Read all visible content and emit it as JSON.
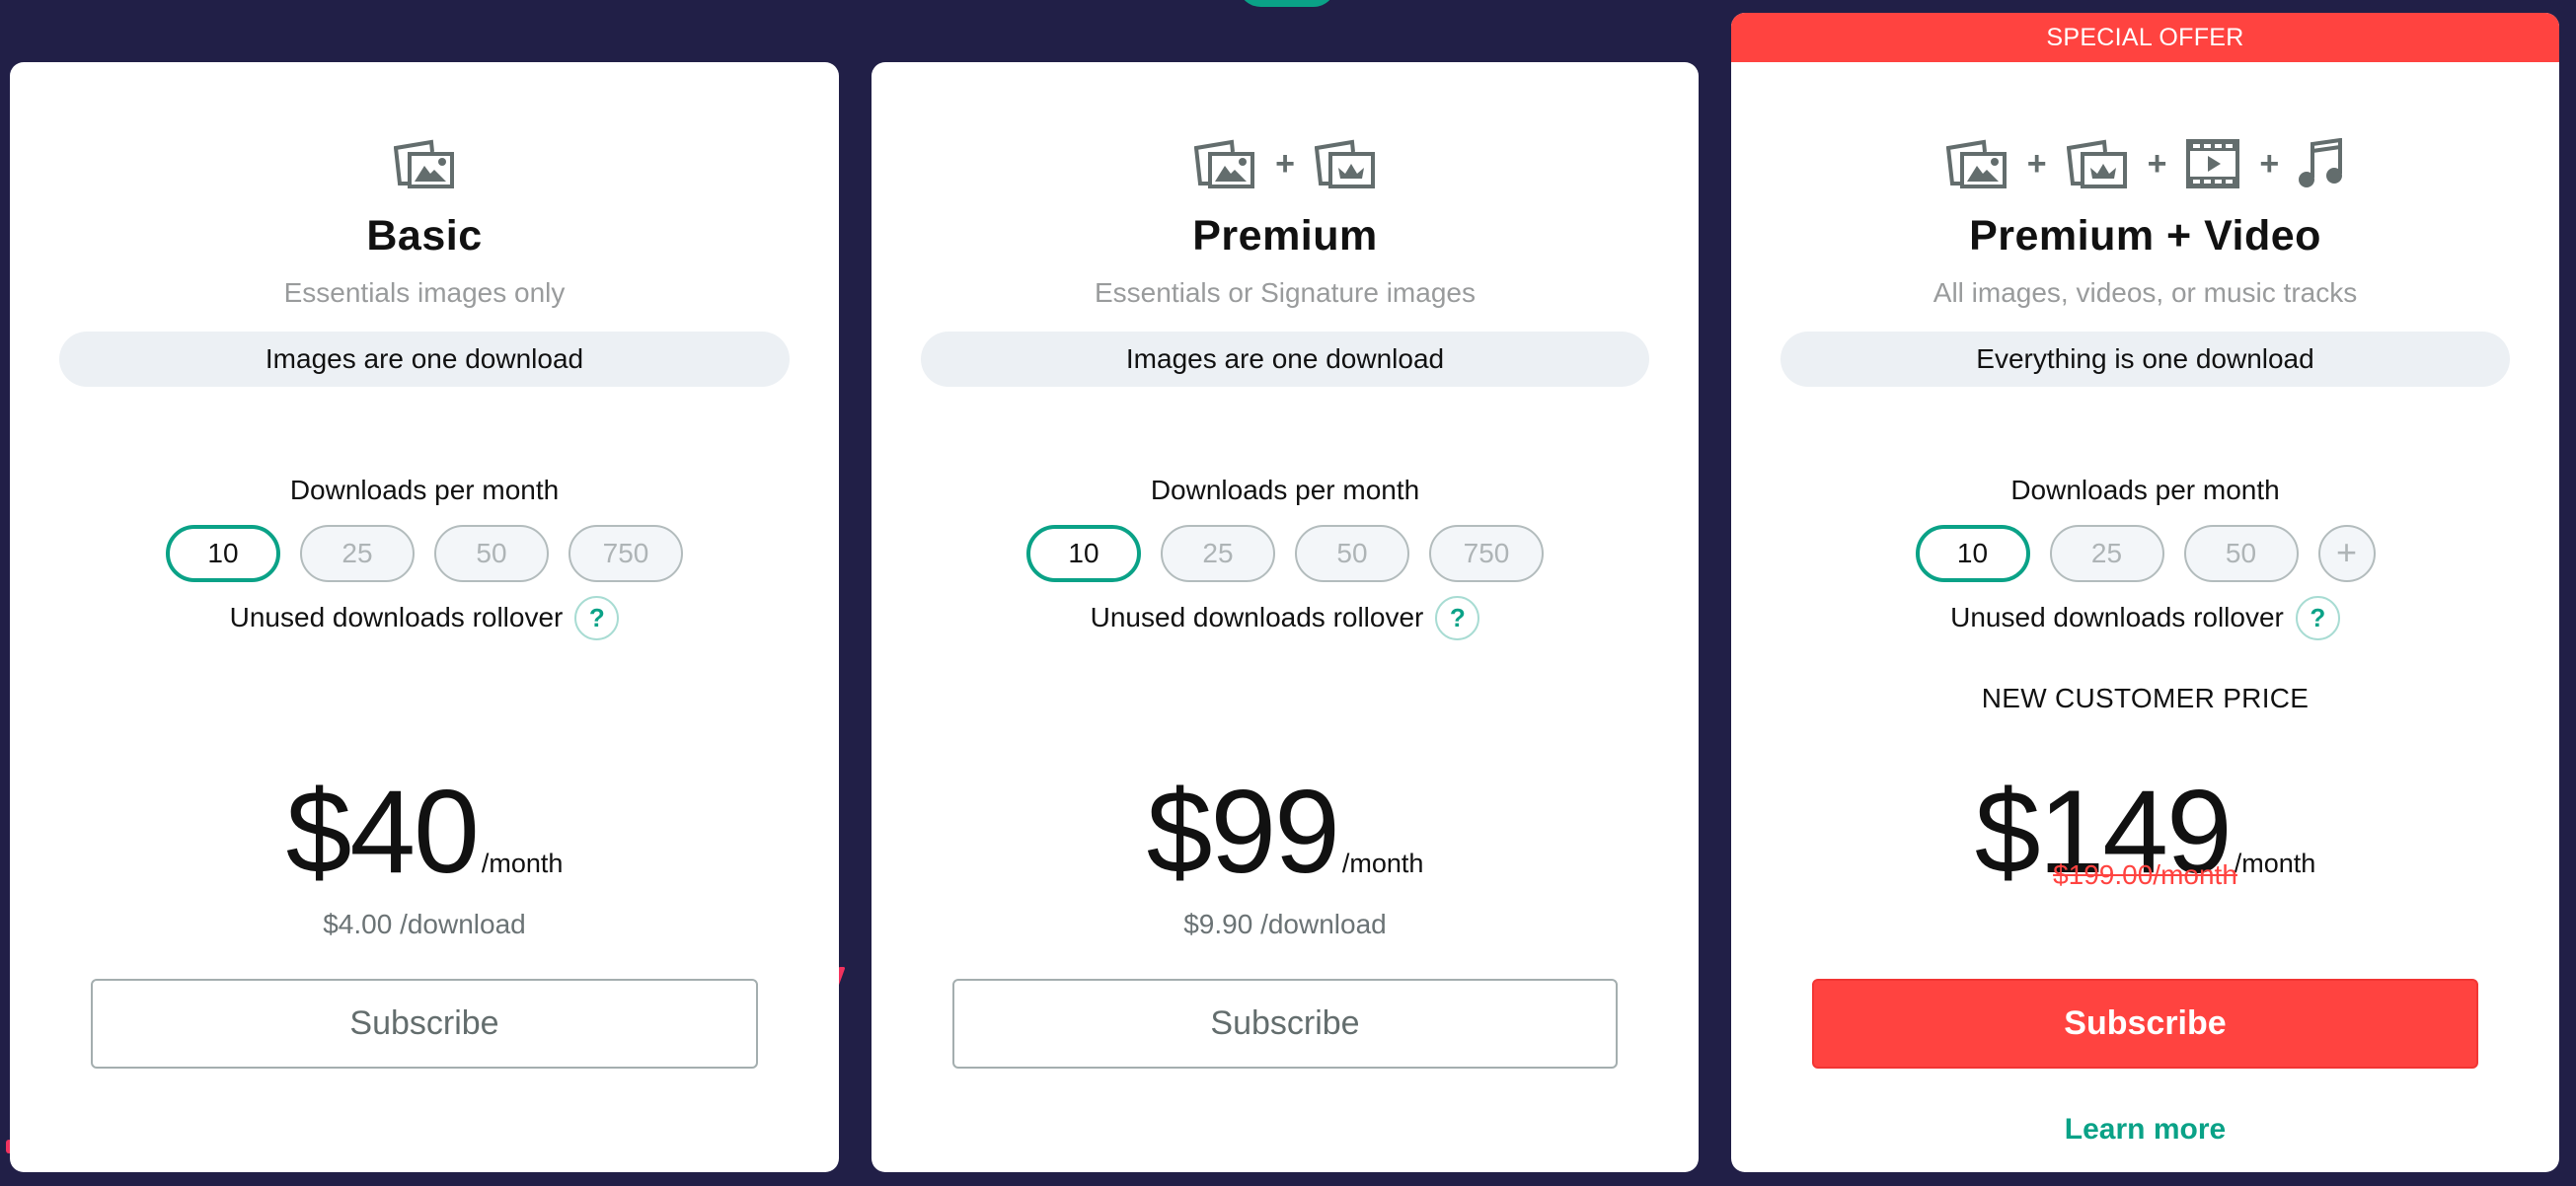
{
  "colors": {
    "background": "#211F47",
    "accent_green": "#0AA287",
    "offer_red": "#FF4340",
    "icon_gray": "#636D6D"
  },
  "plans": [
    {
      "id": "basic",
      "icons": [
        "image-stack-icon"
      ],
      "title": "Basic",
      "subtitle": "Essentials images only",
      "info": "Images are one download",
      "downloads_label": "Downloads per month",
      "options": [
        "10",
        "25",
        "50",
        "750"
      ],
      "selected_option": "10",
      "rollover_label": "Unused downloads rollover",
      "help_label": "?",
      "price": "$40",
      "price_unit": "/month",
      "per_download": "$4.00 /download",
      "subscribe_label": "Subscribe"
    },
    {
      "id": "premium",
      "icons": [
        "image-stack-icon",
        "plus",
        "signature-image-icon"
      ],
      "title": "Premium",
      "subtitle": "Essentials or Signature images",
      "info": "Images are one download",
      "downloads_label": "Downloads per month",
      "options": [
        "10",
        "25",
        "50",
        "750"
      ],
      "selected_option": "10",
      "rollover_label": "Unused downloads rollover",
      "help_label": "?",
      "price": "$99",
      "price_unit": "/month",
      "per_download": "$9.90 /download",
      "subscribe_label": "Subscribe"
    },
    {
      "id": "premium-video",
      "badge": "SPECIAL OFFER",
      "icons": [
        "image-stack-icon",
        "plus",
        "signature-image-icon",
        "plus",
        "video-film-icon",
        "plus",
        "music-note-icon"
      ],
      "title": "Premium + Video",
      "subtitle": "All images, videos, or music tracks",
      "info": "Everything is one download",
      "downloads_label": "Downloads per month",
      "options": [
        "10",
        "25",
        "50",
        "+"
      ],
      "selected_option": "10",
      "rollover_label": "Unused downloads rollover",
      "help_label": "?",
      "new_customer_label": "NEW CUSTOMER PRICE",
      "price": "$149",
      "price_unit": "/month",
      "original_price": "$199.00/month",
      "subscribe_label": "Subscribe",
      "learn_more_label": "Learn more"
    }
  ],
  "plus_sign": "+"
}
